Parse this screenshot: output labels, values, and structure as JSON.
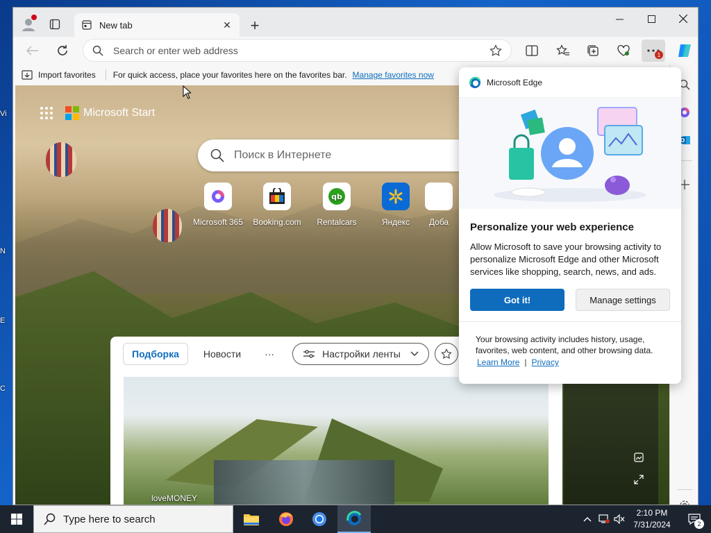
{
  "desktop": {
    "labels": [
      "Vi",
      "N",
      "E",
      "C"
    ]
  },
  "tab": {
    "title": "New tab",
    "close": "✕"
  },
  "newtab": "+",
  "address": {
    "placeholder": "Search or enter web address"
  },
  "menu_badge": "1",
  "favbar": {
    "import_label": "Import favorites",
    "hint": "For quick access, place your favorites here on the favorites bar.",
    "link": "Manage favorites now"
  },
  "newtab_page": {
    "brand": "Microsoft Start",
    "search_placeholder": "Поиск в Интернете",
    "tiles": [
      {
        "label": "Microsoft 365"
      },
      {
        "label": "Booking.com"
      },
      {
        "label": "Rentalcars"
      },
      {
        "label": "Яндекс"
      },
      {
        "label": "Доба"
      }
    ],
    "feed_tabs": {
      "selected": "Подборка",
      "news": "Новости",
      "more": "···",
      "settings": "Настройки ленты"
    },
    "feed_source": "loveMONEY"
  },
  "flyout": {
    "header": "Microsoft Edge",
    "title": "Personalize your web experience",
    "body": "Allow Microsoft to save your browsing activity to personalize Microsoft Edge and other Microsoft services like shopping, search, news, and ads.",
    "primary": "Got it!",
    "secondary": "Manage settings",
    "footer": "Your browsing activity includes history, usage, favorites, web content, and other browsing data.",
    "learn_more": "Learn More",
    "separator": "|",
    "privacy": "Privacy"
  },
  "taskbar": {
    "search_placeholder": "Type here to search",
    "time": "2:10 PM",
    "date": "7/31/2024",
    "notifications": "2"
  },
  "colors": {
    "accent": "#0f6cbd",
    "taskbar": "#1c2430"
  }
}
